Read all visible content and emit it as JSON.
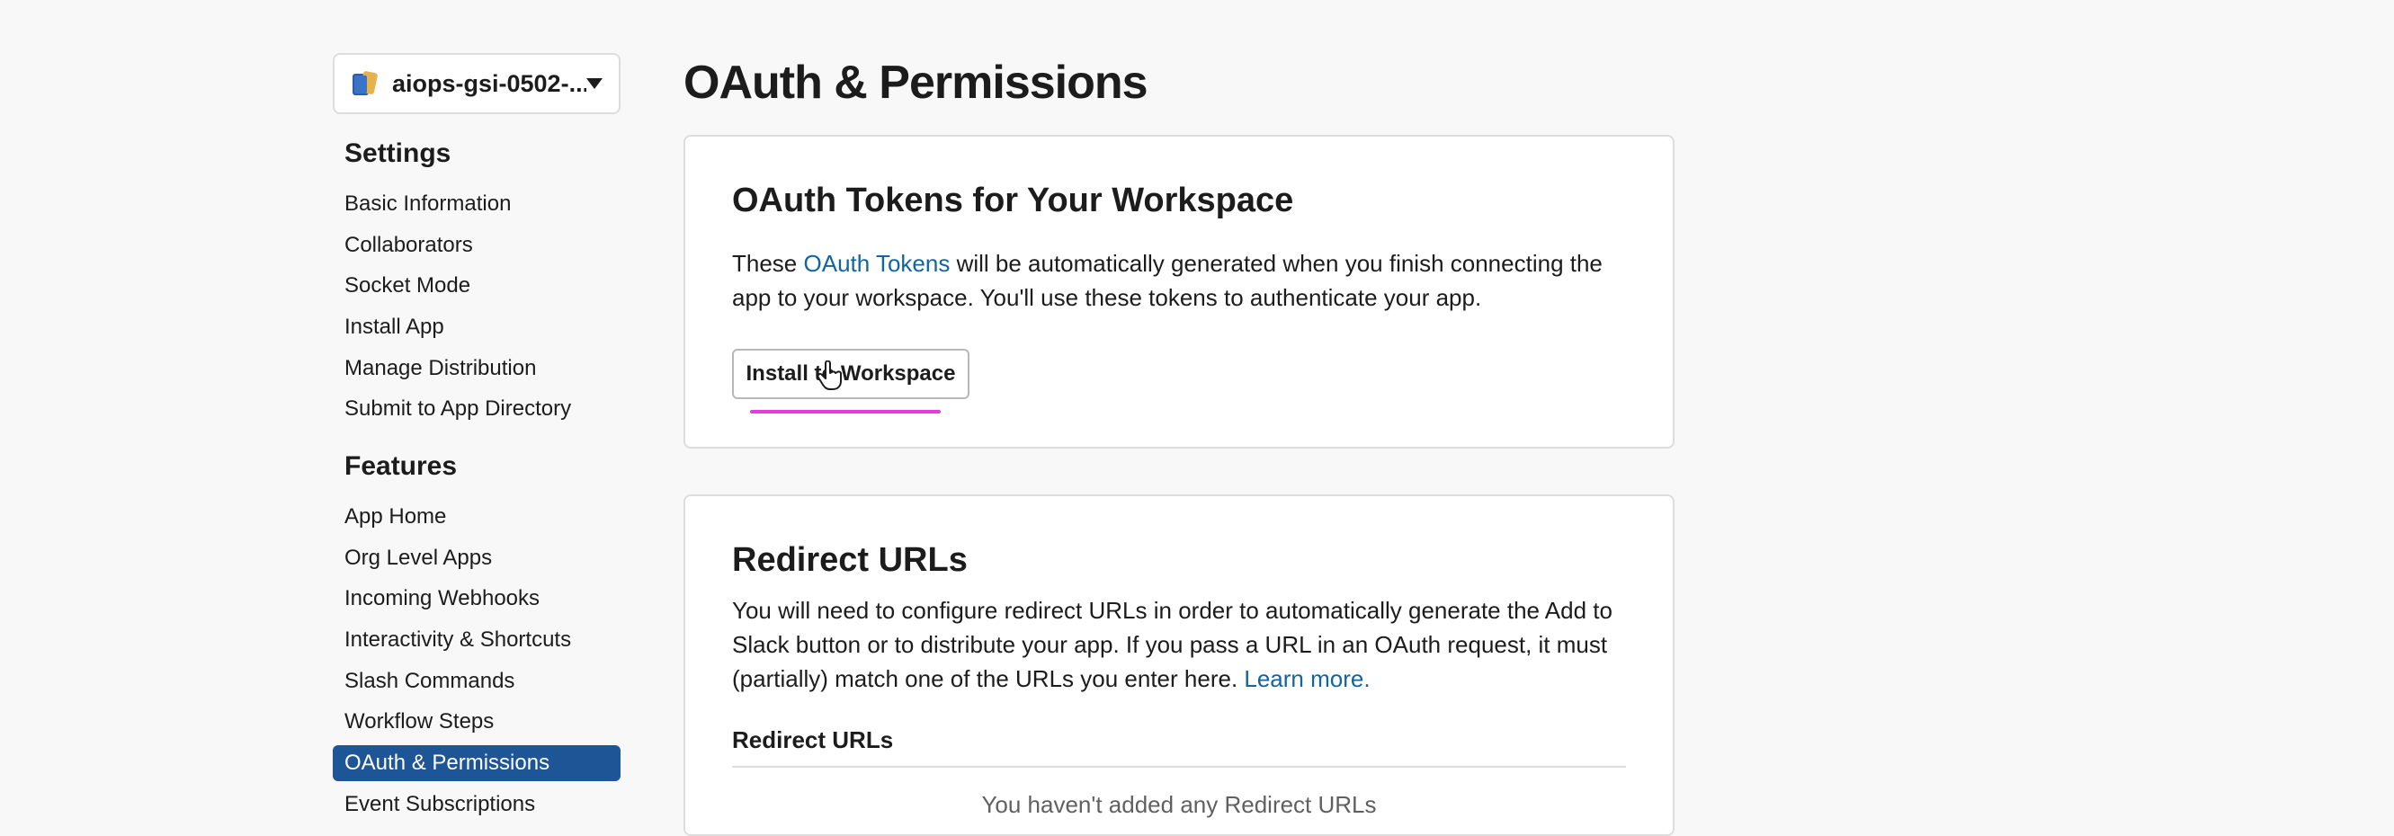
{
  "app_selector": {
    "name": "aiops-gsi-0502-...",
    "icon": "app-book-icon"
  },
  "sidebar": {
    "settings_title": "Settings",
    "settings_items": [
      "Basic Information",
      "Collaborators",
      "Socket Mode",
      "Install App",
      "Manage Distribution",
      "Submit to App Directory"
    ],
    "features_title": "Features",
    "features_items": [
      "App Home",
      "Org Level Apps",
      "Incoming Webhooks",
      "Interactivity & Shortcuts",
      "Slash Commands",
      "Workflow Steps",
      "OAuth & Permissions",
      "Event Subscriptions"
    ],
    "active_item": "OAuth & Permissions"
  },
  "page": {
    "title": "OAuth & Permissions"
  },
  "tokens_card": {
    "title": "OAuth Tokens for Your Workspace",
    "text_before_link": "These ",
    "link": "OAuth Tokens",
    "text_after_link": " will be automatically generated when you finish connecting the app to your workspace. You'll use these tokens to authenticate your app.",
    "button": "Install to Workspace"
  },
  "redirect_card": {
    "title": "Redirect URLs",
    "text": "You will need to configure redirect URLs in order to automatically generate the Add to Slack button or to distribute your app. If you pass a URL in an OAuth request, it must (partially) match one of the URLs you enter here. ",
    "link": "Learn more.",
    "subheading": "Redirect URLs",
    "empty_text": "You haven't added any Redirect URLs"
  },
  "colors": {
    "active_bg": "#1d5596",
    "link": "#1264a3",
    "highlight": "#e33ddf"
  }
}
